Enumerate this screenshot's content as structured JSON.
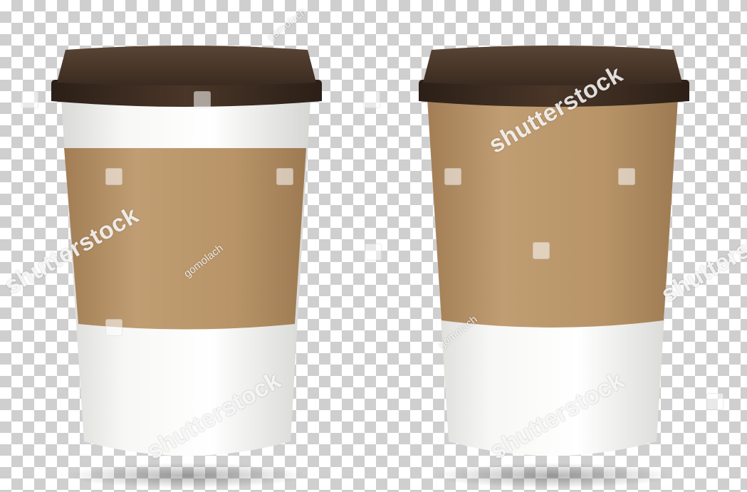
{
  "watermarks": {
    "brand": "shutterstock",
    "author": "gomolach"
  },
  "colors": {
    "lid": "#3b2a1f",
    "sleeve": "#b8956a",
    "cup": "#f4f4f2",
    "checker_dark": "#cfcfcf",
    "checker_light": "#ffffff"
  }
}
